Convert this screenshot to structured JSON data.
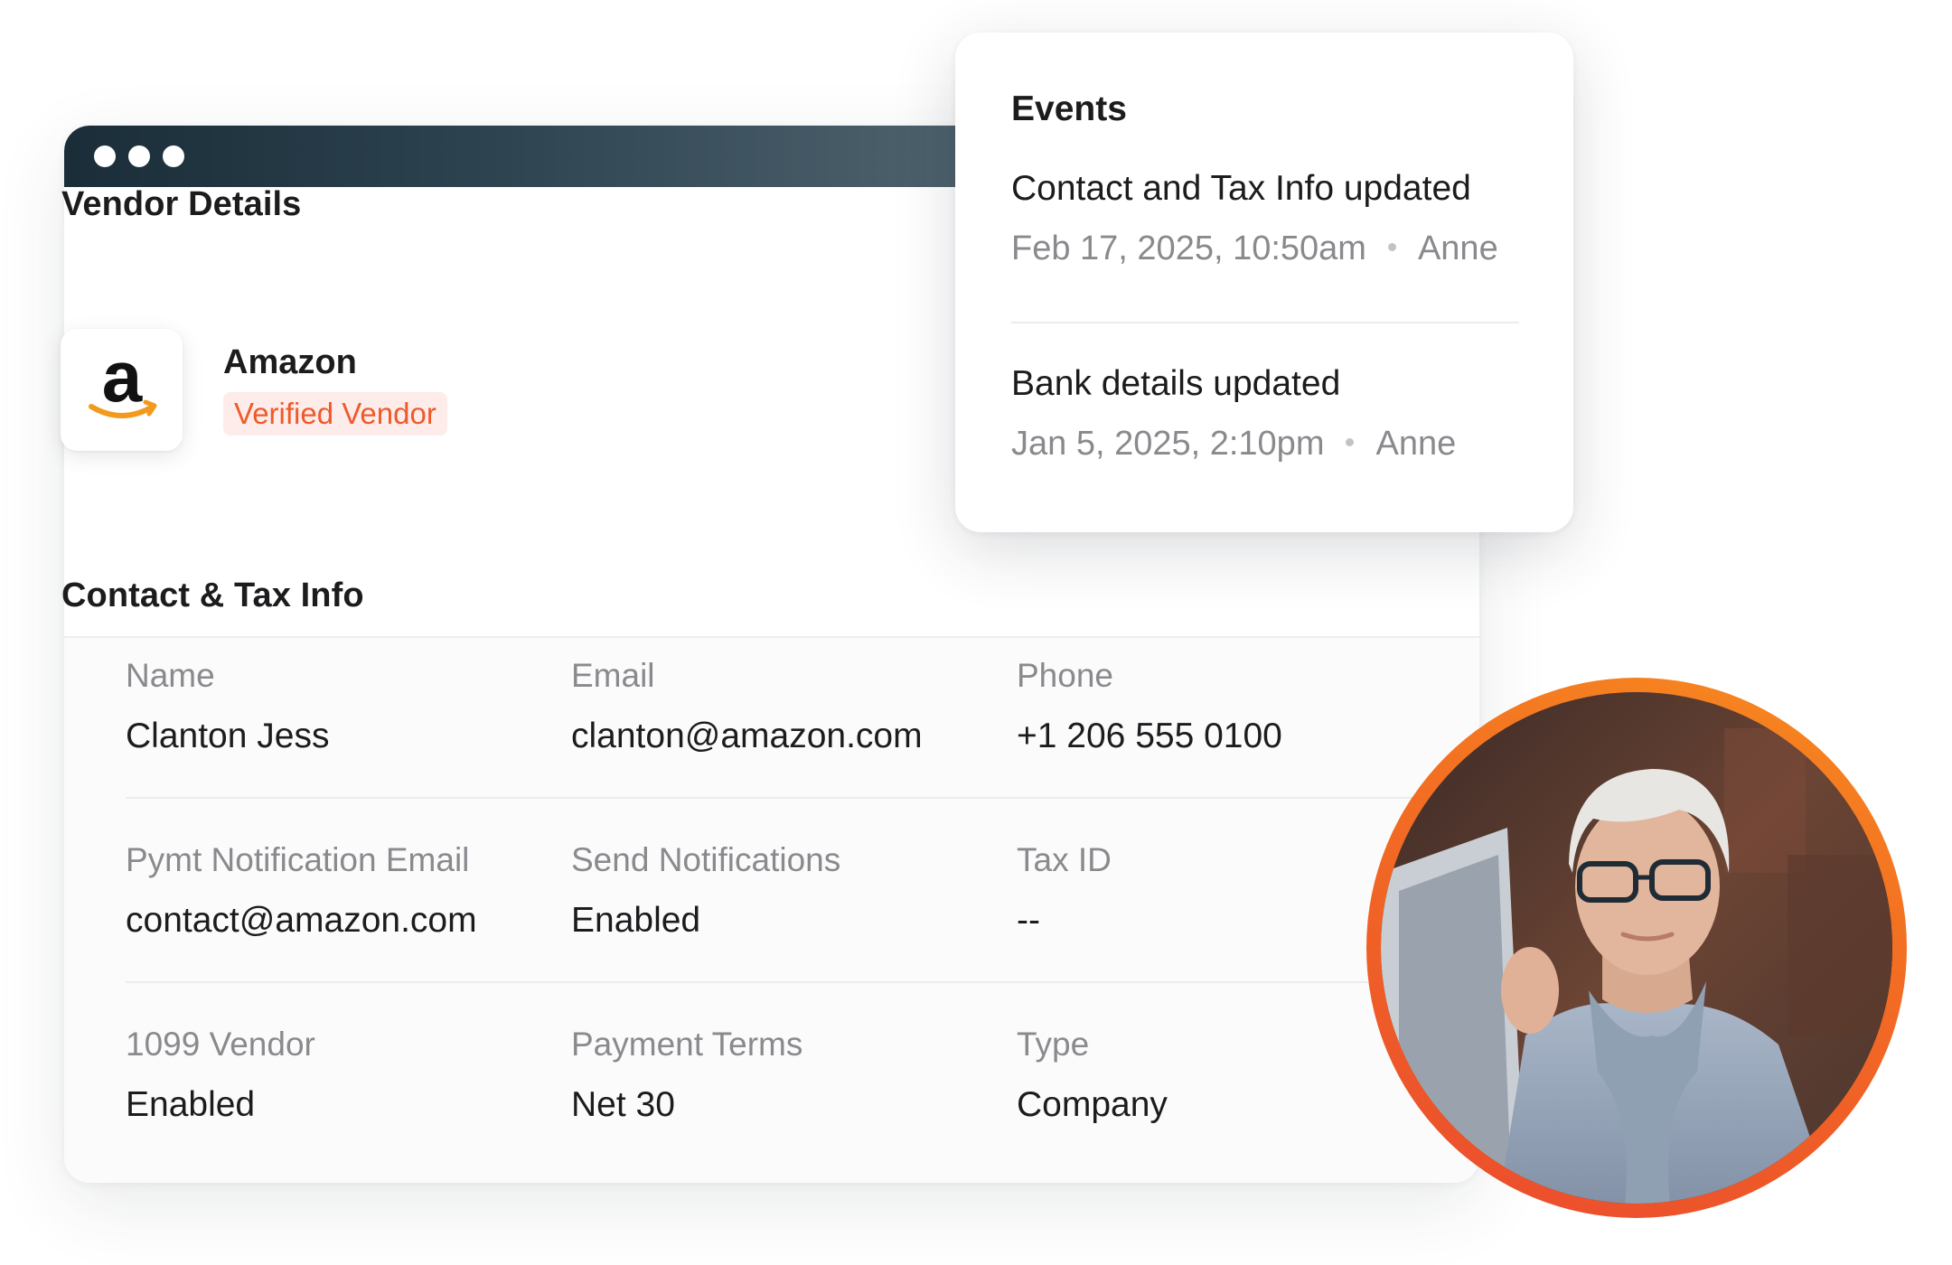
{
  "vendor_details": {
    "title": "Vendor Details",
    "logo_icon": "amazon-logo-icon",
    "vendor_name": "Amazon",
    "badge": "Verified Vendor",
    "badge_color": "#ef5a2a"
  },
  "contact_tax": {
    "title": "Contact & Tax Info",
    "fields": [
      {
        "label": "Name",
        "value": "Clanton Jess"
      },
      {
        "label": "Email",
        "value": "clanton@amazon.com"
      },
      {
        "label": "Phone",
        "value": "+1 206 555 0100"
      },
      {
        "label": "Pymt Notification Email",
        "value": "contact@amazon.com"
      },
      {
        "label": "Send Notifications",
        "value": "Enabled"
      },
      {
        "label": "Tax ID",
        "value": "--"
      },
      {
        "label": "1099 Vendor",
        "value": "Enabled"
      },
      {
        "label": "Payment Terms",
        "value": "Net 30"
      },
      {
        "label": "Type",
        "value": "Company"
      }
    ]
  },
  "events": {
    "title": "Events",
    "items": [
      {
        "title": "Contact and Tax Info updated",
        "timestamp": "Feb 17, 2025, 10:50am",
        "user": "Anne"
      },
      {
        "title": "Bank details updated",
        "timestamp": "Jan 5, 2025, 2:10pm",
        "user": "Anne"
      }
    ]
  },
  "window": {
    "controls": [
      "window-dot-icon",
      "window-dot-icon",
      "window-dot-icon"
    ]
  },
  "avatar": {
    "ring_colors": [
      "#f78a1f",
      "#ea4a2e"
    ]
  }
}
